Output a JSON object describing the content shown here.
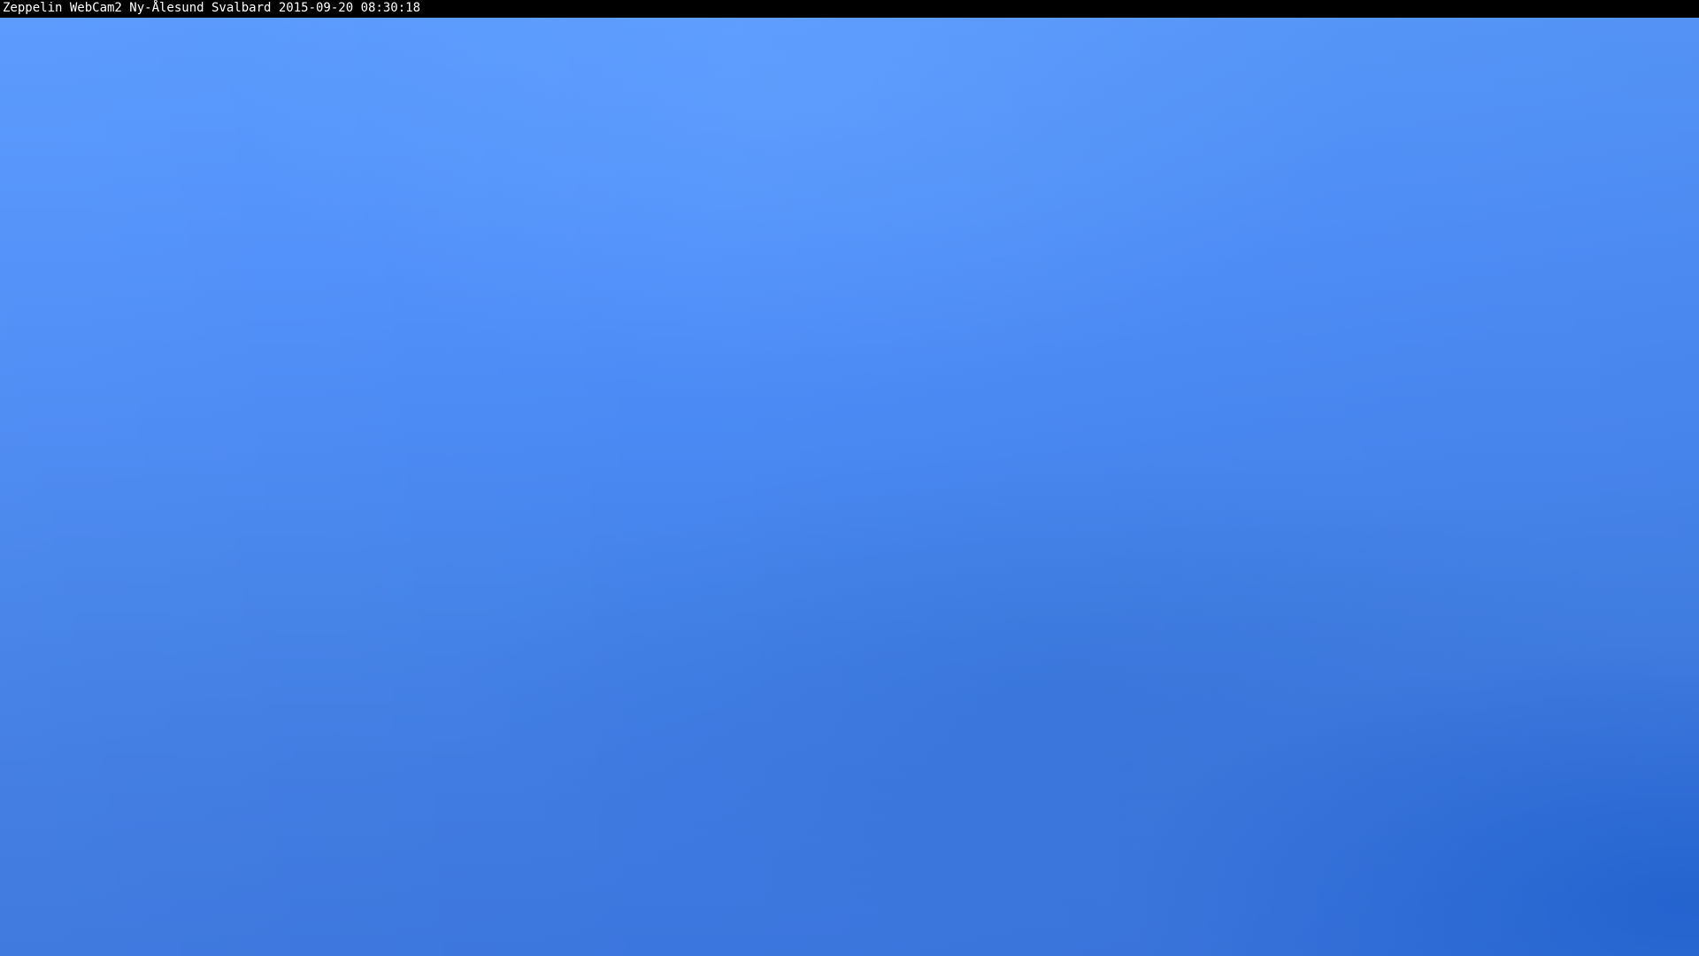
{
  "webcam": {
    "caption": "Zeppelin WebCam2 Ny-Ålesund Svalbard 2015-09-20 08:30:18"
  },
  "colors": {
    "caption_bar": "#000000",
    "caption_text": "#ffffff",
    "sky_top": "#5899fd",
    "sky_bottom": "#3b76de",
    "lower_right_tint": "#145acd"
  }
}
